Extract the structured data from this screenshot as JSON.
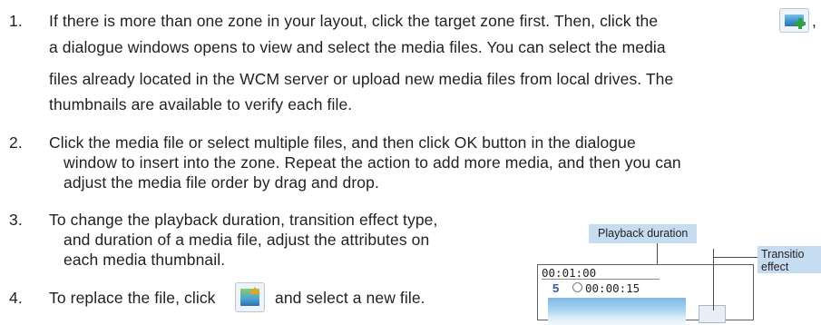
{
  "steps": [
    {
      "number": "1.",
      "lines": [
        "If there is more than one zone in your layout, click the target zone first. Then, click the",
        ",",
        "a dialogue windows opens to view and select the media files. You can select the media",
        "files already located in the WCM server or upload new media files from local drives. The",
        "thumbnails are available to verify each file."
      ]
    },
    {
      "number": "2.",
      "lines": [
        "Click the media file or select multiple files, and then click OK button in the dialogue",
        "window to insert into the zone. Repeat the action to add more media, and then you can",
        "adjust the media file order by drag and drop."
      ]
    },
    {
      "number": "3.",
      "lines": [
        "To change the playback duration, transition effect type,",
        "and duration of a media file, adjust the attributes on",
        "each media thumbnail."
      ]
    },
    {
      "number": "4.",
      "lines": [
        "To replace the file, click",
        "and select a new file."
      ]
    }
  ],
  "icons": {
    "add_media": "add-media-icon",
    "replace_file": "replace-file-icon"
  },
  "figure": {
    "playback_label": "Playback duration",
    "transition_label_line1": "Transitio",
    "transition_label_line2": "effect",
    "zone_duration": "00:01:00",
    "order_number": "5",
    "item_duration": "00:00:15"
  },
  "colors": {
    "text": "#231f20",
    "callout": "#c5dcf1",
    "order_number": "#2a5aa8"
  }
}
